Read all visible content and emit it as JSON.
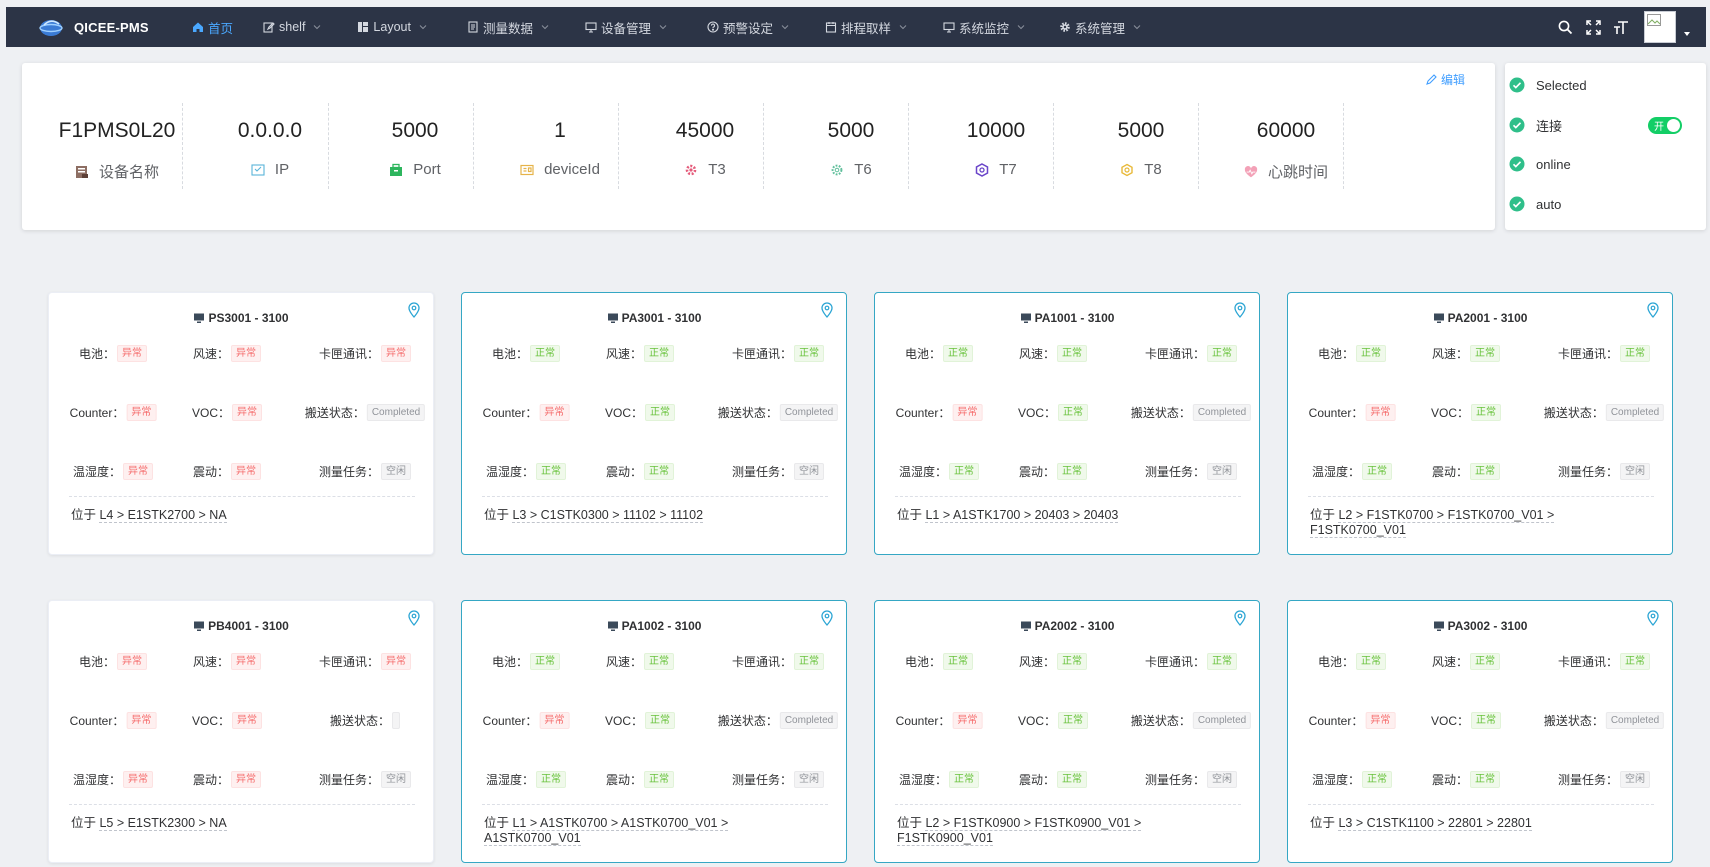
{
  "app": {
    "title": "QICEE-PMS"
  },
  "nav": {
    "items": [
      {
        "label": "首页",
        "icon": "home-icon",
        "active": true,
        "caret": false
      },
      {
        "label": "shelf",
        "icon": "edit-icon",
        "active": false,
        "caret": true
      },
      {
        "label": "Layout",
        "icon": "layout-icon",
        "active": false,
        "caret": true
      },
      {
        "label": "测量数据",
        "icon": "document-icon",
        "active": false,
        "caret": true
      },
      {
        "label": "设备管理",
        "icon": "monitor-icon",
        "active": false,
        "caret": true
      },
      {
        "label": "预警设定",
        "icon": "question-icon",
        "active": false,
        "caret": true
      },
      {
        "label": "排程取样",
        "icon": "calendar-icon",
        "active": false,
        "caret": true
      },
      {
        "label": "系统监控",
        "icon": "monitor-icon",
        "active": false,
        "caret": true
      },
      {
        "label": "系统管理",
        "icon": "gear-icon",
        "active": false,
        "caret": true
      }
    ],
    "right_icons": [
      "search-icon",
      "fullscreen-icon",
      "font-size-icon"
    ]
  },
  "device": {
    "edit_label": "编辑",
    "stats": [
      {
        "value": "F1PMS0L20",
        "label": "设备名称",
        "icon": "device-name-icon"
      },
      {
        "value": "0.0.0.0",
        "label": "IP",
        "icon": "ip-icon"
      },
      {
        "value": "5000",
        "label": "Port",
        "icon": "port-icon"
      },
      {
        "value": "1",
        "label": "deviceId",
        "icon": "device-id-icon"
      },
      {
        "value": "45000",
        "label": "T3",
        "icon": "t3-icon"
      },
      {
        "value": "5000",
        "label": "T6",
        "icon": "t6-icon"
      },
      {
        "value": "10000",
        "label": "T7",
        "icon": "t7-icon"
      },
      {
        "value": "5000",
        "label": "T8",
        "icon": "t8-icon"
      },
      {
        "value": "60000",
        "label": "心跳时间",
        "icon": "heartbeat-icon"
      }
    ]
  },
  "status": {
    "rows": [
      {
        "label": "Selected"
      },
      {
        "label": "连接",
        "switch": {
          "on": true,
          "text": "开"
        }
      },
      {
        "label": "online"
      },
      {
        "label": "auto"
      }
    ]
  },
  "labels": {
    "battery": "电池：",
    "wind": "风速：",
    "card_comm": "卡匣通讯：",
    "counter": "Counter：",
    "voc": "VOC：",
    "transport": "搬送状态：",
    "temp": "温湿度：",
    "vibration": "震动：",
    "task": "测量任务：",
    "location_prefix": "位于 "
  },
  "colors": {
    "ok_border": "#35a7c4",
    "nav_bg": "#2c3446",
    "accent": "#409eff"
  },
  "shelves": [
    {
      "name": "PS3001 - 3100",
      "state": "bad",
      "battery": "异常",
      "wind": "异常",
      "card_comm": "异常",
      "counter": "异常",
      "voc": "异常",
      "transport": "Completed",
      "temp": "异常",
      "vibration": "异常",
      "task": "空闲",
      "location": [
        "L4 > E1STK2700 > NA"
      ]
    },
    {
      "name": "PA3001 - 3100",
      "state": "ok",
      "battery": "正常",
      "wind": "正常",
      "card_comm": "正常",
      "counter": "异常",
      "voc": "正常",
      "transport": "Completed",
      "temp": "正常",
      "vibration": "正常",
      "task": "空闲",
      "location": [
        "L3 > C1STK0300 > 11102 > 11102"
      ]
    },
    {
      "name": "PA1001 - 3100",
      "state": "ok",
      "battery": "正常",
      "wind": "正常",
      "card_comm": "正常",
      "counter": "异常",
      "voc": "正常",
      "transport": "Completed",
      "temp": "正常",
      "vibration": "正常",
      "task": "空闲",
      "location": [
        "L1 > A1STK1700 > 20403 > 20403"
      ]
    },
    {
      "name": "PA2001 - 3100",
      "state": "ok",
      "battery": "正常",
      "wind": "正常",
      "card_comm": "正常",
      "counter": "异常",
      "voc": "正常",
      "transport": "Completed",
      "temp": "正常",
      "vibration": "正常",
      "task": "空闲",
      "location": [
        "L2 > F1STK0700 > F1STK0700_V01 >",
        "F1STK0700_V01"
      ]
    },
    {
      "name": "PB4001 - 3100",
      "state": "bad",
      "battery": "异常",
      "wind": "异常",
      "card_comm": "异常",
      "counter": "异常",
      "voc": "异常",
      "transport": "",
      "temp": "异常",
      "vibration": "异常",
      "task": "空闲",
      "location": [
        "L5 > E1STK2300 > NA"
      ]
    },
    {
      "name": "PA1002 - 3100",
      "state": "ok",
      "battery": "正常",
      "wind": "正常",
      "card_comm": "正常",
      "counter": "异常",
      "voc": "正常",
      "transport": "Completed",
      "temp": "正常",
      "vibration": "正常",
      "task": "空闲",
      "location": [
        "L1 > A1STK0700 > A1STK0700_V01 >",
        "A1STK0700_V01"
      ]
    },
    {
      "name": "PA2002 - 3100",
      "state": "ok",
      "battery": "正常",
      "wind": "正常",
      "card_comm": "正常",
      "counter": "异常",
      "voc": "正常",
      "transport": "Completed",
      "temp": "正常",
      "vibration": "正常",
      "task": "空闲",
      "location": [
        "L2 > F1STK0900 > F1STK0900_V01 >",
        "F1STK0900_V01"
      ]
    },
    {
      "name": "PA3002 - 3100",
      "state": "ok",
      "battery": "正常",
      "wind": "正常",
      "card_comm": "正常",
      "counter": "异常",
      "voc": "正常",
      "transport": "Completed",
      "temp": "正常",
      "vibration": "正常",
      "task": "空闲",
      "location": [
        "L3 > C1STK1100 > 22801 > 22801"
      ]
    }
  ]
}
